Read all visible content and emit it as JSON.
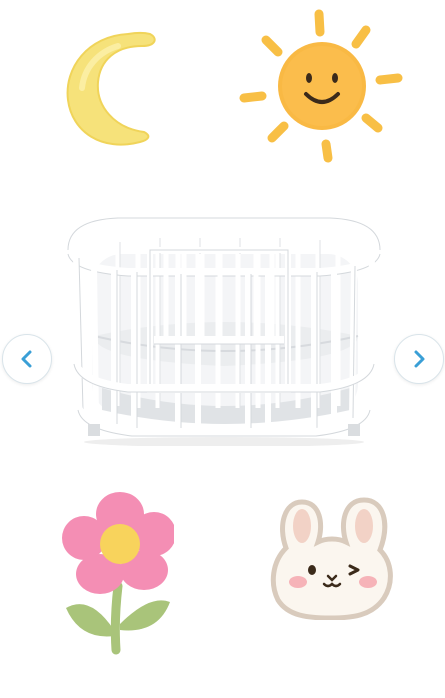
{
  "gallery": {
    "product_image": "white-oval-crib",
    "prev_icon": "chevron-left-icon",
    "next_icon": "chevron-right-icon",
    "accent_color": "#3a9fd6"
  },
  "decorations": {
    "top_left": "moon-sticker",
    "top_right": "sun-sticker",
    "bottom_left": "flower-sticker",
    "bottom_right": "bunny-sticker"
  }
}
